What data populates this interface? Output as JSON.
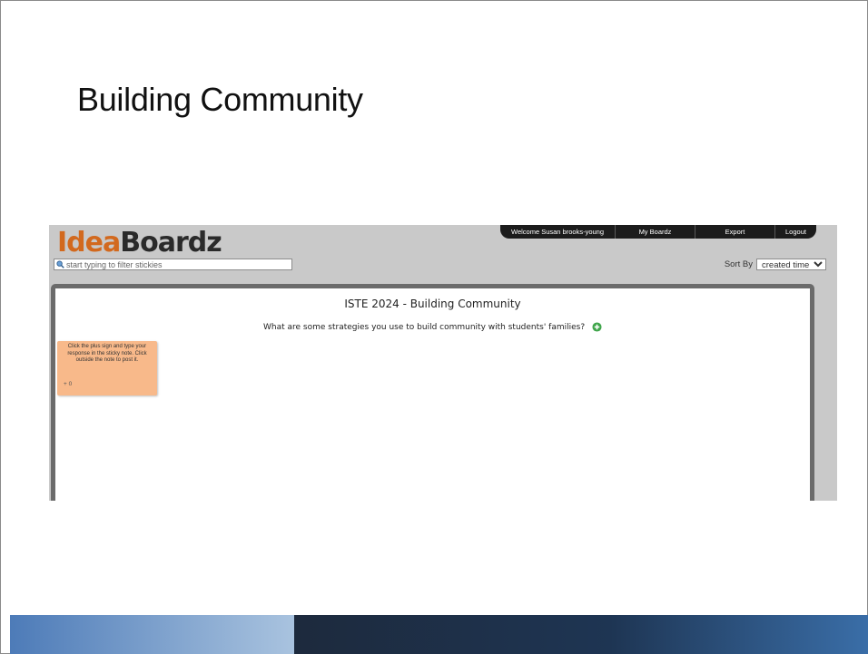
{
  "slide": {
    "title": "Building Community"
  },
  "app": {
    "logo_part1": "Idea",
    "logo_part2": "Boardz",
    "colors": {
      "logo_accent": "#d2691e",
      "nav_bg": "#1c1c1c",
      "sticky": "#f8b98a",
      "board_border": "#6b6b6b"
    }
  },
  "filter": {
    "placeholder": "start typing to filter stickies"
  },
  "nav": {
    "welcome": "Welcome Susan brooks-young",
    "my_boardz": "My Boardz",
    "export": "Export",
    "logout": "Logout"
  },
  "sort": {
    "label": "Sort By",
    "selected": "created time"
  },
  "board": {
    "title": "ISTE 2024 - Building Community",
    "question": "What are some strategies you use to build community with students' families?",
    "add_icon": "plus-circle-icon"
  },
  "sticky": {
    "text": "Click the plus sign and type your response in the sticky note. Click outside the note to post it.",
    "votes": "+ 0"
  }
}
